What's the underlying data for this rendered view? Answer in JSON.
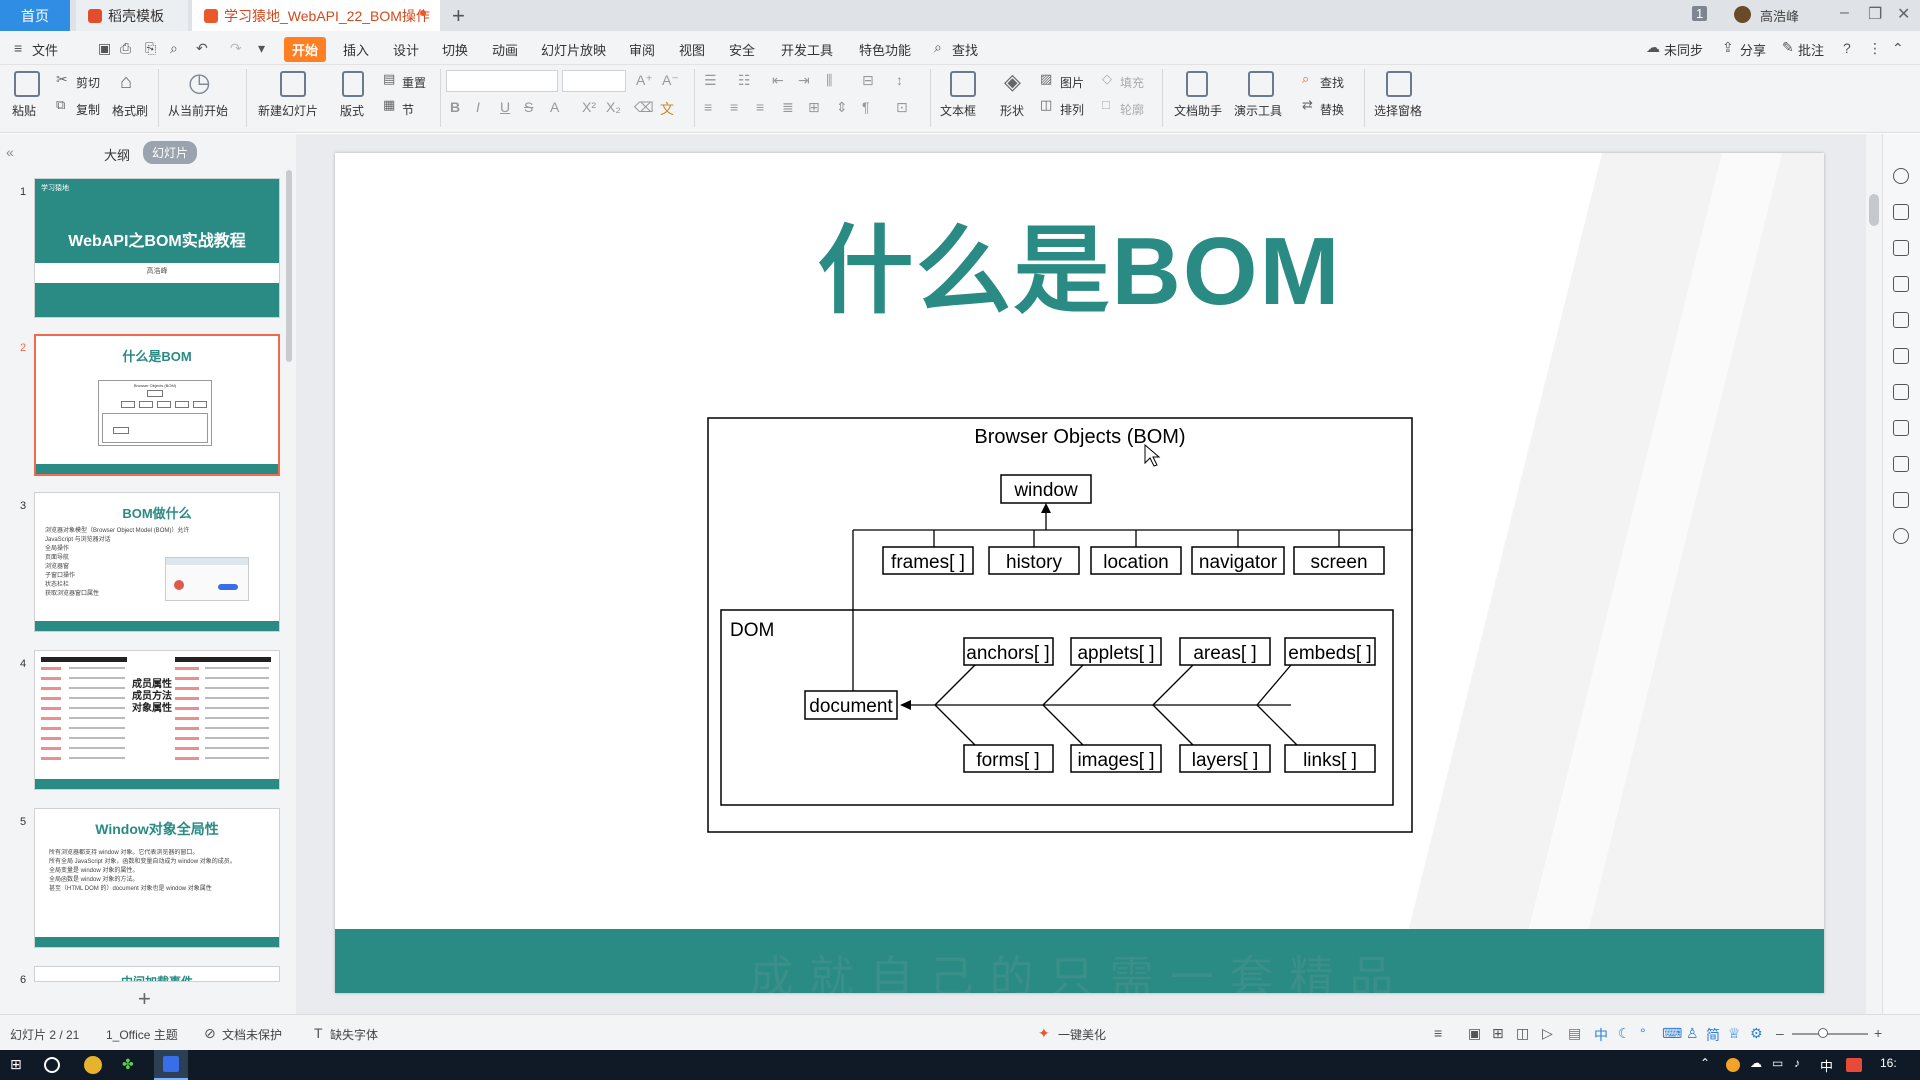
{
  "tabs": {
    "home": "首页",
    "wps": "稻壳模板",
    "doc": "学习猿地_WebAPI_22_BOM操作"
  },
  "titlebar": {
    "badge": "1",
    "user": "高浩峰"
  },
  "menu": {
    "file": "文件",
    "items": [
      "开始",
      "插入",
      "设计",
      "切换",
      "动画",
      "幻灯片放映",
      "审阅",
      "视图",
      "安全",
      "开发工具",
      "特色功能"
    ],
    "search": "查找",
    "right": [
      "未同步",
      "分享",
      "批注"
    ]
  },
  "ribbon": {
    "paste": "粘贴",
    "cut": "剪切",
    "copy": "复制",
    "format_painter": "格式刷",
    "from_current": "从当前开始",
    "new_slide": "新建幻灯片",
    "layout": "版式",
    "reset": "重置",
    "section": "节",
    "textbox": "文本框",
    "shape": "形状",
    "picture": "图片",
    "arrange": "排列",
    "fill": "填充",
    "outline": "轮廓",
    "doc_helper": "文档助手",
    "present_tools": "演示工具",
    "find": "查找",
    "replace": "替换",
    "select_pane": "选择窗格"
  },
  "panel": {
    "outline_tab": "大纲",
    "slides_tab": "幻灯片"
  },
  "thumbnails": [
    {
      "num": "1",
      "title": "WebAPI之BOM实战教程",
      "subtitle": "高浩峰",
      "logo": "学习猿地"
    },
    {
      "num": "2",
      "title": "什么是BOM",
      "diagram_title": "Browser Objects (BOM)"
    },
    {
      "num": "3",
      "title": "BOM做什么",
      "lines": [
        "浏览器对象模型（Browser Object Model (BOM)）允许",
        "JavaScript 与浏览器对话",
        "全局操作",
        "页面导航",
        "浏览器窗",
        "子窗口操作",
        "状态栏栏",
        "获取浏览器窗口属性"
      ]
    },
    {
      "num": "4",
      "labels": [
        "成员属性",
        "成员方法",
        "对象属性"
      ]
    },
    {
      "num": "5",
      "title": "Window对象全局性",
      "lines": [
        "所有浏览器都支持 window 对象。它代表浏览器的窗口。",
        "所有全局 JavaScript 对象，函数和变量自动成为 window 对象的成员。",
        "全局变量是 window 对象的属性。",
        "全局函数是 window 对象的方法。",
        "甚至（HTML DOM 的）document 对象也是 window 对象属性"
      ]
    },
    {
      "num": "6",
      "title": "中间加载事件"
    }
  ],
  "slide": {
    "title": "什么是BOM",
    "diagram": {
      "title": "Browser Objects (BOM)",
      "root": "window",
      "children": [
        "frames[ ]",
        "history",
        "location",
        "navigator",
        "screen"
      ],
      "dom_label": "DOM",
      "document": "document",
      "top_collections": [
        "anchors[ ]",
        "applets[ ]",
        "areas[ ]",
        "embeds[ ]"
      ],
      "bottom_collections": [
        "forms[ ]",
        "images[ ]",
        "layers[ ]",
        "links[ ]"
      ]
    },
    "footer_slogan": "成就自己的只需一套精品"
  },
  "status": {
    "slide_counter": "幻灯片 2 / 21",
    "theme": "1_Office 主题",
    "protection": "文档未保护",
    "missing_fonts": "缺失字体",
    "beautify": "一键美化"
  },
  "taskbar": {
    "ime": "中",
    "time": "16:"
  }
}
